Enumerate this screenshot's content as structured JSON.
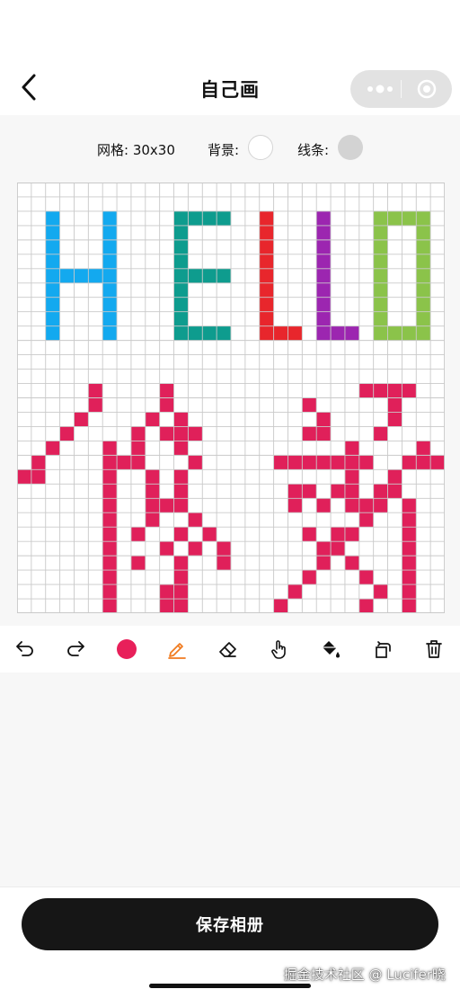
{
  "header": {
    "title": "自己画"
  },
  "settings": {
    "grid_label": "网格: 30x30",
    "bg_label": "背景:",
    "bg_color": "#ffffff",
    "line_label": "线条:",
    "line_color": "#d3d3d3"
  },
  "canvas": {
    "rows": 30,
    "cols": 30,
    "background": "#ffffff",
    "grid_line_color": "#c9c9c9",
    "palette": {
      "B": "#13a9ef",
      "T": "#0e9c8e",
      "R": "#e8262c",
      "P": "#9c26b0",
      "G": "#8bc34a",
      "K": "#e0205a"
    },
    "pixels": [
      "..............................",
      "..............................",
      "..B...B....TTTT..R...P...GGGG.",
      "..B...B....T.....R...P...G..G.",
      "..B...B....T.....R...P...G..G.",
      "..B...B....T.....R...P...G..G.",
      "..BBBBB....TTTT..R...P...G..G.",
      "..B...B....T.....R...P...G..G.",
      "..B...B....T.....R...P...G..G.",
      "..B...B....T.....R...P...G..G.",
      "..B...B....TTTT..RRR.PPP.GGGG.",
      "..............................",
      "..............................",
      "..............................",
      ".....K....K.............KKKK..",
      ".....K....K.........K.....K...",
      "....K....K.K.........K....K...",
      "...K....K.KKK.......KK...K....",
      "..K...K.K..K...........K....K.",
      ".K....KKK...K.....KKKKKKK..KKK",
      "KK....K..K.K...........K..K...",
      "......K..K.K.......KK.KK.KK...",
      "......K..KKK.......K.K.KKK.K..",
      "......K..K..K...........K..K..",
      "......K.K..K.K......K.KK...K..",
      "......K...K.K.K......KK....K..",
      "......K.K..K..K......K.K...K..",
      "......K....K........K...K..K..",
      "......K...KK.......K.....K.K..",
      "......K...KK......K.....K..K.."
    ]
  },
  "toolbar": {
    "active_color": "#e8205a",
    "pen_color": "#f07a1e",
    "tools": [
      {
        "id": "undo",
        "icon": "undo-icon"
      },
      {
        "id": "redo",
        "icon": "redo-icon"
      },
      {
        "id": "color",
        "icon": "color-swatch"
      },
      {
        "id": "pen",
        "icon": "pen-icon"
      },
      {
        "id": "eraser",
        "icon": "eraser-icon"
      },
      {
        "id": "hand",
        "icon": "hand-icon"
      },
      {
        "id": "fill",
        "icon": "paint-bucket-icon"
      },
      {
        "id": "rotate",
        "icon": "rotate-icon"
      },
      {
        "id": "delete",
        "icon": "trash-icon"
      }
    ]
  },
  "footer": {
    "save_label": "保存相册",
    "watermark": "掘金技术社区 @ Lucifer晓"
  }
}
